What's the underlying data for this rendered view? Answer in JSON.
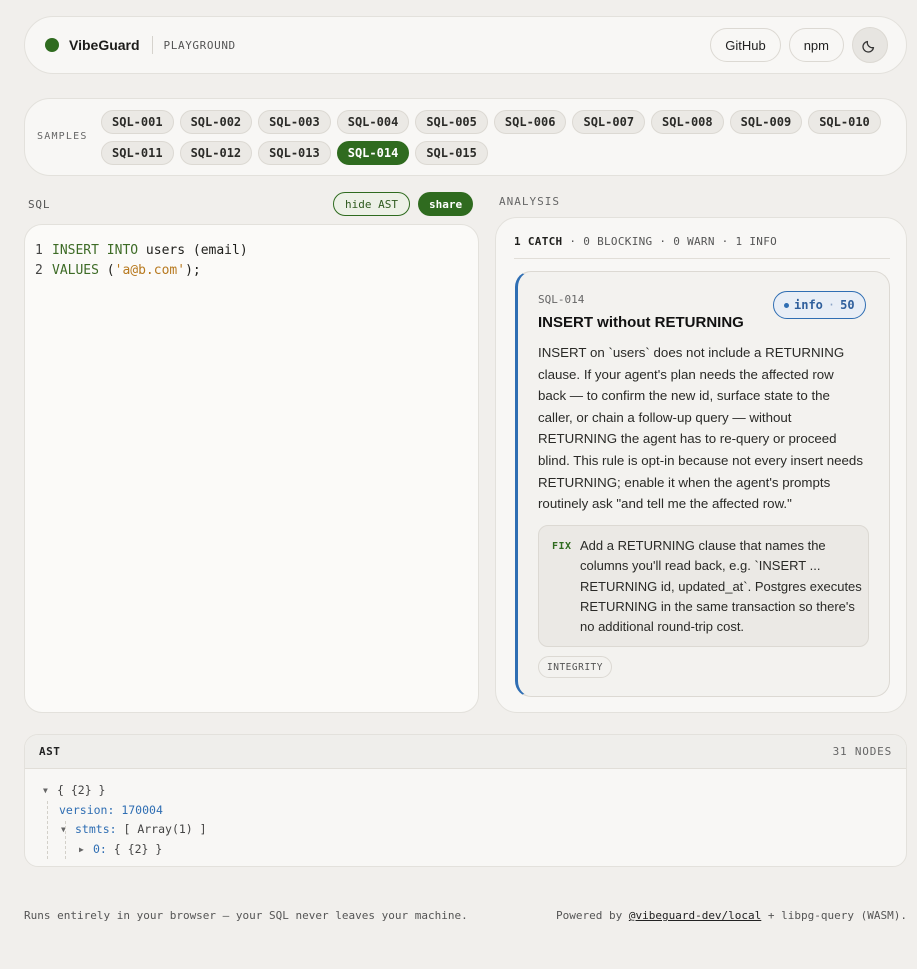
{
  "header": {
    "brand": "VibeGuard",
    "subtitle": "PLAYGROUND",
    "github_label": "GitHub",
    "npm_label": "npm",
    "theme_icon": "moon-icon",
    "accent_color": "#2f6b1f"
  },
  "samples": {
    "label": "SAMPLES",
    "items": [
      "SQL-001",
      "SQL-002",
      "SQL-003",
      "SQL-004",
      "SQL-005",
      "SQL-006",
      "SQL-007",
      "SQL-008",
      "SQL-009",
      "SQL-010",
      "SQL-011",
      "SQL-012",
      "SQL-013",
      "SQL-014",
      "SQL-015"
    ],
    "active": "SQL-014"
  },
  "editor": {
    "label": "SQL",
    "hide_ast_label": "hide AST",
    "share_label": "share",
    "lines": [
      {
        "num": "1",
        "tokens": [
          {
            "t": "INSERT INTO",
            "c": "kw"
          },
          {
            "t": " users (email)",
            "c": ""
          }
        ]
      },
      {
        "num": "2",
        "tokens": [
          {
            "t": "VALUES",
            "c": "kw"
          },
          {
            "t": " (",
            "c": ""
          },
          {
            "t": "'a@b.com'",
            "c": "str"
          },
          {
            "t": ");",
            "c": ""
          }
        ]
      }
    ]
  },
  "analysis": {
    "label": "ANALYSIS",
    "summary": {
      "catch": "1 CATCH",
      "rest": " · 0 BLOCKING · 0 WARN · 1 INFO"
    },
    "finding": {
      "id": "SQL-014",
      "title": "INSERT without RETURNING",
      "severity": "info",
      "score": "50",
      "severity_color": "#2f6eb3",
      "body": "INSERT on `users` does not include a RETURNING clause. If your agent's plan needs the affected row back — to confirm the new id, surface state to the caller, or chain a follow-up query — without RETURNING the agent has to re-query or proceed blind. This rule is opt-in because not every insert needs RETURNING; enable it when the agent's prompts routinely ask \"and tell me the affected row.\"",
      "fix_label": "FIX",
      "fix_text": "Add a RETURNING clause that names the columns you'll read back, e.g. `INSERT ... RETURNING id, updated_at`. Postgres executes RETURNING in the same transaction so there's no additional round-trip cost.",
      "tag": "INTEGRITY"
    }
  },
  "ast": {
    "title": "AST",
    "node_count": "31 NODES",
    "root": "{ {2} }",
    "version_key": "version:",
    "version_val": "170004",
    "stmts_key": "stmts:",
    "stmts_val": "[ Array(1) ]",
    "item_key": "0:",
    "item_val": "{ {2} }"
  },
  "footer": {
    "left": "Runs entirely in your browser — your SQL never leaves your machine.",
    "powered": "Powered by ",
    "link": "@vibeguard-dev/local",
    "rest": " + libpg-query (WASM)."
  }
}
